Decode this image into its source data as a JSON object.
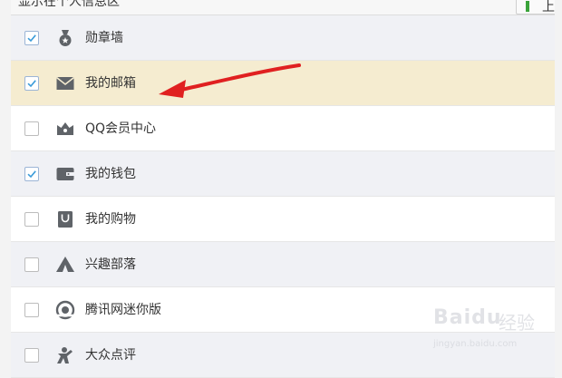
{
  "header": {
    "title": "显示在个人信息区",
    "move_up_label": "上移"
  },
  "items": [
    {
      "label": "勋章墙",
      "checked": true,
      "icon": "medal-icon",
      "style": "alt"
    },
    {
      "label": "我的邮箱",
      "checked": true,
      "icon": "mail-icon",
      "style": "highlight"
    },
    {
      "label": "QQ会员中心",
      "checked": false,
      "icon": "crown-icon",
      "style": "white"
    },
    {
      "label": "我的钱包",
      "checked": true,
      "icon": "wallet-icon",
      "style": "alt"
    },
    {
      "label": "我的购物",
      "checked": false,
      "icon": "shopping-bag-icon",
      "style": "white"
    },
    {
      "label": "兴趣部落",
      "checked": false,
      "icon": "tent-icon",
      "style": "alt"
    },
    {
      "label": "腾讯网迷你版",
      "checked": false,
      "icon": "tencent-news-icon",
      "style": "white"
    },
    {
      "label": "大众点评",
      "checked": false,
      "icon": "dianping-icon",
      "style": "alt"
    }
  ],
  "watermark": {
    "brand": "Baidu",
    "jingyan": "经验",
    "url": "jingyan.baidu.com"
  },
  "colors": {
    "highlight_row": "#f5ecd0",
    "alt_row": "#f0f1f5",
    "icon_gray": "#5f6368",
    "check_blue": "#3a9bd9",
    "arrow_red": "#e02020"
  }
}
